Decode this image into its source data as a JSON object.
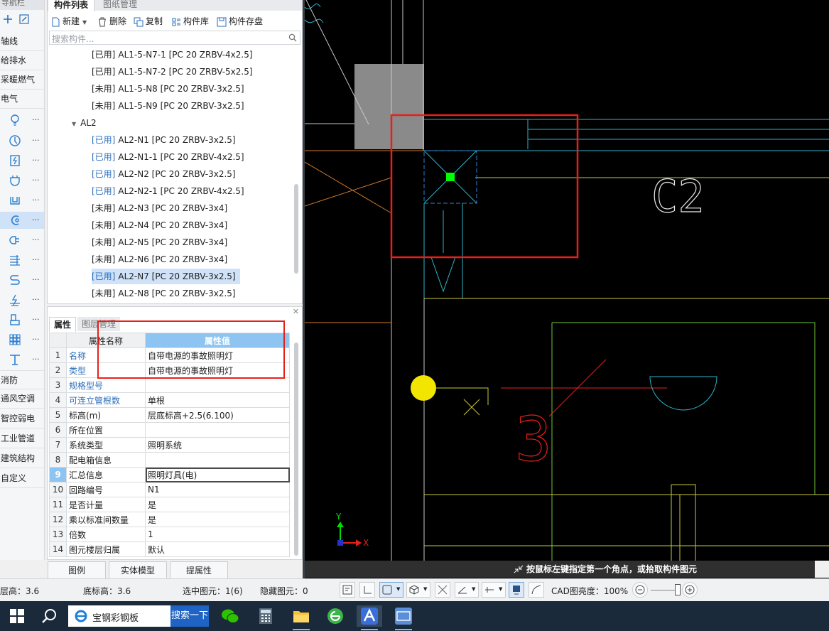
{
  "nav": {
    "title": "导航栏",
    "categories_top": [
      "轴线",
      "给排水",
      "采暖燃气",
      "电气"
    ],
    "icons": [
      "bulb-icon",
      "switch-icon",
      "panel-box-icon",
      "socket-icon",
      "trough-icon",
      "curve-pipe-icon",
      "plug-icon",
      "ladder-icon",
      "wire-icon",
      "ground-icon",
      "device-icon",
      "grid-icon",
      "pole-icon"
    ],
    "more": "...",
    "categories_bottom": [
      "消防",
      "通风空调",
      "智控弱电",
      "工业管道",
      "建筑结构",
      "自定义"
    ]
  },
  "component_panel": {
    "tabs": [
      "构件列表",
      "图纸管理"
    ],
    "toolbar": {
      "new": "新建",
      "delete": "删除",
      "copy": "复制",
      "library": "构件库",
      "save": "构件存盘"
    },
    "search_placeholder": "搜索构件...",
    "group_label": "AL2",
    "items_before": [
      {
        "status": "[已用]",
        "name": "AL1-5-N7-1 [PC 20 ZRBV-4x2.5]",
        "used": false
      },
      {
        "status": "[已用]",
        "name": "AL1-5-N7-2 [PC 20 ZRBV-5x2.5]",
        "used": false
      },
      {
        "status": "[未用]",
        "name": "AL1-5-N8 [PC 20 ZRBV-3x2.5]",
        "used": false
      },
      {
        "status": "[未用]",
        "name": "AL1-5-N9 [PC 20 ZRBV-3x2.5]",
        "used": false
      }
    ],
    "items_after": [
      {
        "status": "[已用]",
        "name": "AL2-N1 [PC 20 ZRBV-3x2.5]",
        "used": true
      },
      {
        "status": "[已用]",
        "name": "AL2-N1-1 [PC 20 ZRBV-4x2.5]",
        "used": true
      },
      {
        "status": "[已用]",
        "name": "AL2-N2 [PC 20 ZRBV-3x2.5]",
        "used": true
      },
      {
        "status": "[已用]",
        "name": "AL2-N2-1 [PC 20 ZRBV-4x2.5]",
        "used": true
      },
      {
        "status": "[未用]",
        "name": "AL2-N3 [PC 20 ZRBV-3x4]",
        "used": false
      },
      {
        "status": "[未用]",
        "name": "AL2-N4 [PC 20 ZRBV-3x4]",
        "used": false
      },
      {
        "status": "[未用]",
        "name": "AL2-N5 [PC 20 ZRBV-3x4]",
        "used": false
      },
      {
        "status": "[未用]",
        "name": "AL2-N6 [PC 20 ZRBV-3x4]",
        "used": false
      },
      {
        "status": "[已用]",
        "name": "AL2-N7 [PC 20 ZRBV-3x2.5]",
        "used": true,
        "selected": true
      },
      {
        "status": "[未用]",
        "name": "AL2-N8 [PC 20 ZRBV-3x2.5]",
        "used": false
      }
    ]
  },
  "properties": {
    "tabs": [
      "属性",
      "图层管理"
    ],
    "col_name": "属性名称",
    "col_value": "属性值",
    "rows": [
      {
        "n": "1",
        "name": "名称",
        "value": "自带电源的事故照明灯",
        "blue": true
      },
      {
        "n": "2",
        "name": "类型",
        "value": "自带电源的事故照明灯",
        "blue": true
      },
      {
        "n": "3",
        "name": "规格型号",
        "value": "",
        "blue": true
      },
      {
        "n": "4",
        "name": "可连立管根数",
        "value": "单根",
        "blue": true
      },
      {
        "n": "5",
        "name": "标高(m)",
        "value": "层底标高+2.5(6.100)",
        "blue": false
      },
      {
        "n": "6",
        "name": "所在位置",
        "value": "",
        "blue": false
      },
      {
        "n": "7",
        "name": "系统类型",
        "value": "照明系统",
        "blue": false
      },
      {
        "n": "8",
        "name": "配电箱信息",
        "value": "",
        "blue": false
      },
      {
        "n": "9",
        "name": "汇总信息",
        "value": "照明灯具(电)",
        "blue": false,
        "current": true
      },
      {
        "n": "10",
        "name": "回路编号",
        "value": "N1",
        "blue": false
      },
      {
        "n": "11",
        "name": "是否计量",
        "value": "是",
        "blue": false
      },
      {
        "n": "12",
        "name": "乘以标准间数量",
        "value": "是",
        "blue": false
      },
      {
        "n": "13",
        "name": "倍数",
        "value": "1",
        "blue": false
      },
      {
        "n": "14",
        "name": "图元楼层归属",
        "value": "默认",
        "blue": false
      }
    ],
    "buttons": {
      "legend": "图例",
      "solid_model": "实体模型",
      "pick": "提属性"
    }
  },
  "cad": {
    "label_c2": "C2",
    "label_3": "3",
    "axis_y": "Y",
    "axis_x": "X",
    "hint": "按鼠标左键指定第一个角点，或拾取构件图元"
  },
  "status": {
    "floor_height": "层高：3.6",
    "base_height": "底标高：3.6",
    "selected": "选中图元：1(6)",
    "hidden": "隐藏图元：0",
    "cad_brightness": "CAD图亮度：100%"
  },
  "taskbar": {
    "search_text": "宝钢彩钢板",
    "search_button": "搜索一下",
    "apps": [
      "windows-start-icon",
      "search-icon",
      "wechat-icon",
      "calculator-icon",
      "file-explorer-icon",
      "browser-icon",
      "glodon-app-icon",
      "cad-app-icon"
    ]
  },
  "colors": {
    "selection_red": "#e8201a",
    "cad_yellow": "#c8c83a",
    "cad_cyan": "#2fb3c8",
    "cad_green": "#00ff00",
    "header_blue": "#8dc4f1"
  }
}
